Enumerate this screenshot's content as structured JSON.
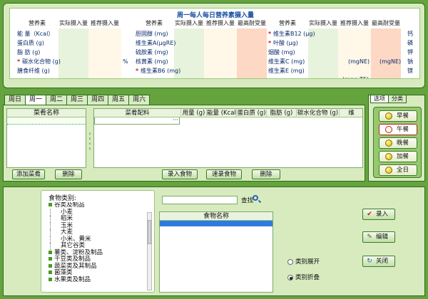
{
  "nutrition": {
    "title": "周一每人每日营养素摄入量",
    "headers": [
      "营养素",
      "实际摄入量",
      "推荐摄入量",
      "营养素",
      "实际摄入量",
      "推荐摄入量",
      "最高耐受量",
      "营养素",
      "实际摄入量",
      "推荐摄入量",
      "最高耐受量"
    ],
    "group1": [
      {
        "label": "能 量（Kcal）",
        "star": false
      },
      {
        "label": "蛋白质 (g)",
        "star": false
      },
      {
        "label": "脂 肪 (g)",
        "star": false
      },
      {
        "label": "碳水化合物 (g)",
        "star": true
      },
      {
        "label": "膳食纤维 (g)",
        "star": false
      }
    ],
    "group1_unit": "%",
    "group2": [
      {
        "label": "胆固醇 (mg)",
        "star": false
      },
      {
        "label": "维生素A(μgRE)",
        "star": false
      },
      {
        "label": "硫胺素 (mg)",
        "star": false
      },
      {
        "label": "核黄素 (mg)",
        "star": false
      },
      {
        "label": "维生素B6 (mg)",
        "star": true
      }
    ],
    "group3": [
      {
        "label": "维生素B12 (μg)",
        "star": true
      },
      {
        "label": "叶酸 (μg)",
        "star": true
      },
      {
        "label": "烟酸 (mg)",
        "star": false
      },
      {
        "label": "维生素C (mg)",
        "star": false
      },
      {
        "label": "维生素E (mg)",
        "star": false
      }
    ],
    "group3_max_units": [
      "(mgNE)",
      "(mgα-TE)"
    ],
    "group3_max_units_right": "(mgNE)",
    "group4": [
      "钙",
      "磷",
      "钾",
      "钠",
      "镁"
    ]
  },
  "day_tabs": [
    "周日",
    "周一",
    "周二",
    "周三",
    "周四",
    "周五",
    "周六"
  ],
  "active_day": "周一",
  "dish_list": {
    "header": "菜肴名称"
  },
  "recipe_grid": {
    "headers": [
      "菜肴配料",
      "用量 (g)",
      "能量 (Kcal)",
      "蛋白质 (g)",
      "脂肪 (g)",
      "碳水化合物 (g)",
      "维"
    ],
    "ellipsis": "···"
  },
  "buttons": {
    "add_dish": "添加菜肴",
    "delete_dish": "删除",
    "enter_food": "录入食物",
    "quick_food": "速录食物",
    "delete_food": "删除"
  },
  "right_tabs": [
    "选项",
    "分类"
  ],
  "meals": [
    "早餐",
    "午餐",
    "晚餐",
    "加餐",
    "全日"
  ],
  "selected_meal": "午餐",
  "food_category": {
    "label": "食物类别:",
    "tree": [
      {
        "text": "谷类及制品",
        "level": 0
      },
      {
        "text": "小麦",
        "level": 1
      },
      {
        "text": "稻米",
        "level": 1
      },
      {
        "text": "玉米",
        "level": 1
      },
      {
        "text": "大麦",
        "level": 1
      },
      {
        "text": "小米、黄米",
        "level": 1
      },
      {
        "text": "其它谷类",
        "level": 1
      },
      {
        "text": "薯类、淀粉及制品",
        "level": 0
      },
      {
        "text": "干豆类及制品",
        "level": 0
      },
      {
        "text": "蔬菜类及其制品",
        "level": 0
      },
      {
        "text": "菌藻类",
        "level": 0
      },
      {
        "text": "水果类及制品",
        "level": 0
      }
    ]
  },
  "search": {
    "value": "",
    "label": "查找"
  },
  "food_list": {
    "header": "食物名称"
  },
  "radios": {
    "expand": "类别展开",
    "collapse": "类别折叠"
  },
  "actions": {
    "enter": "录入",
    "edit": "编辑",
    "close": "关闭"
  }
}
